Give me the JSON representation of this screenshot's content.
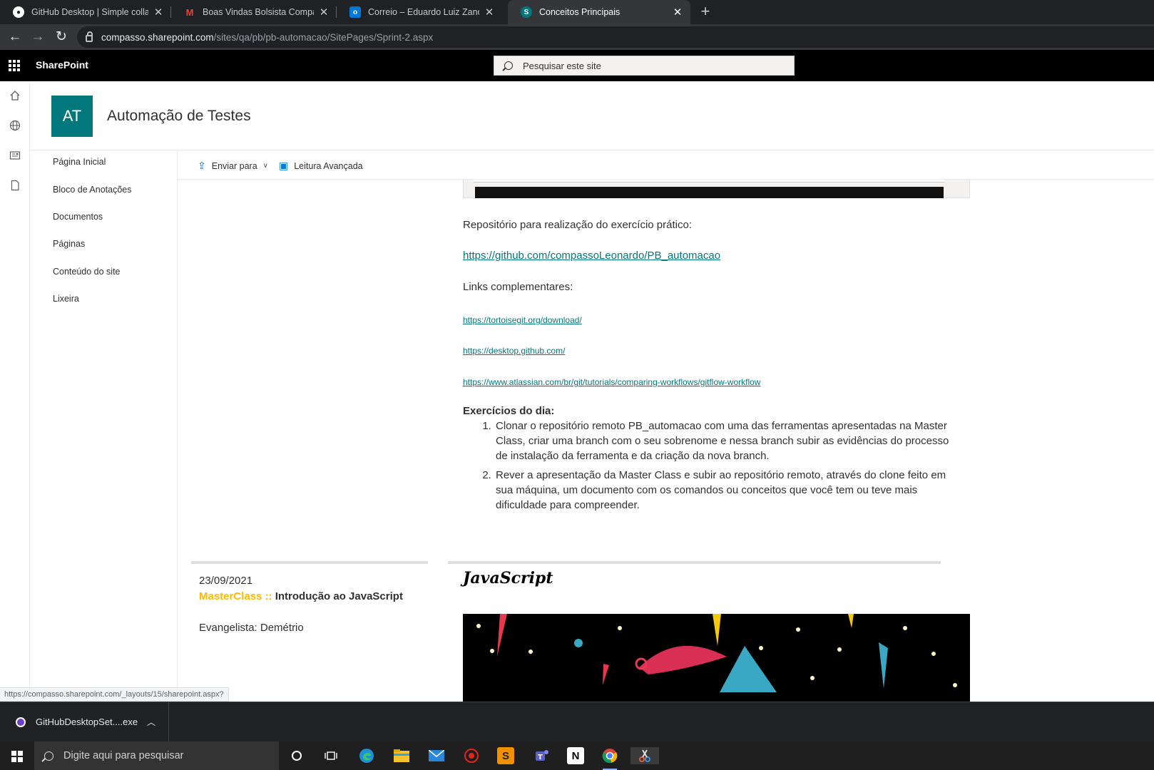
{
  "browser": {
    "tabs": [
      {
        "title": "GitHub Desktop | Simple collabo",
        "favicon": "github-icon",
        "color": "#ffffff"
      },
      {
        "title": "Boas Vindas Bolsista Compasso U",
        "favicon": "gmail-icon",
        "color": "#ea4335"
      },
      {
        "title": "Correio – Eduardo Luiz Zanotto –",
        "favicon": "outlook-icon",
        "color": "#0078d4"
      },
      {
        "title": "Conceitos Principais",
        "favicon": "sharepoint-icon",
        "color": "#03787c"
      }
    ],
    "new_tab": "+",
    "close_glyph": "✕",
    "url_host": "compasso.sharepoint.com",
    "url_path": "/sites/qa/pb/pb-automacao/SitePages/Sprint-2.aspx"
  },
  "suite": {
    "brand": "SharePoint",
    "search_placeholder": "Pesquisar este site"
  },
  "site": {
    "logo_text": "AT",
    "logo_color": "#03787c",
    "title": "Automação de Testes"
  },
  "nav": [
    "Página Inicial",
    "Bloco de Anotações",
    "Documentos",
    "Páginas",
    "Conteúdo do site",
    "Lixeira"
  ],
  "commands": {
    "send_to": "Enviar para",
    "immersive_reader": "Leitura Avançada"
  },
  "main": {
    "repo_label": "Repositório para realização do exercício prático:",
    "repo_link": "https://github.com/compassoLeonardo/PB_automacao",
    "links_label": "Links complementares:",
    "links": [
      "https://tortoisegit.org/download/",
      "https://desktop.github.com/",
      "https://www.atlassian.com/br/git/tutorials/comparing-workflows/gitflow-workflow"
    ],
    "exercises_heading": "Exercícios do dia:",
    "exercises": [
      "Clonar o repositório remoto PB_automacao com uma das ferramentas apresentadas na Master Class, criar uma branch com o seu sobrenome e nessa branch subir as evidências do processo de instalação da ferramenta e da criação da nova branch.",
      "Rever a apresentação da Master Class e subir ao repositório remoto, através do clone feito em sua máquina, um documento com os comandos ou conceitos que você tem ou teve mais dificuldade para compreender."
    ],
    "date": "23/09/2021",
    "masterclass_prefix": "MasterClass ::",
    "masterclass_title": "Introdução ao JavaScript",
    "masterclass_color": "#ffb900",
    "evangelist": "Evangelista: Demétrio",
    "js_heading": "JavaScript"
  },
  "status_url": "https://compasso.sharepoint.com/_layouts/15/sharepoint.aspx?",
  "download": {
    "filename": "GitHubDesktopSet....exe"
  },
  "taskbar": {
    "search_placeholder": "Digite aqui para pesquisar"
  }
}
